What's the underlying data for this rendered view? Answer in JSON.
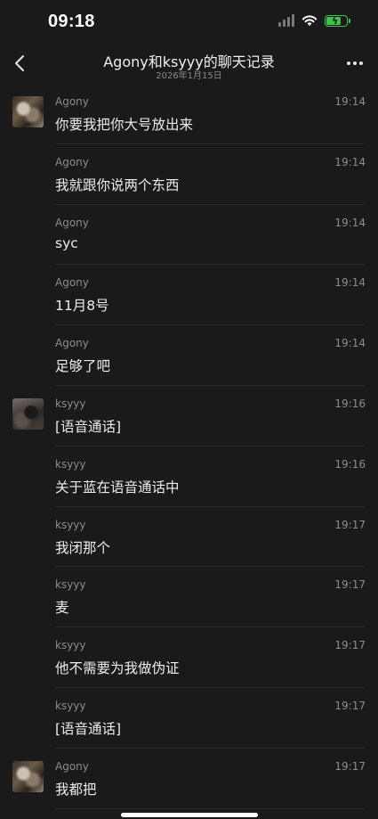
{
  "status_bar": {
    "time": "09:18",
    "battery_color": "#3ec24d",
    "battery_level": 0.8
  },
  "header": {
    "title": "Agony和ksyyy的聊天记录",
    "subtitle": "2026年1月15日",
    "back_icon": "chevron-left-icon",
    "more_icon": "more-dots-icon"
  },
  "messages": [
    {
      "sender": "Agony",
      "time": "19:14",
      "text": "你要我把你大号放出来",
      "avatar": "agony"
    },
    {
      "sender": "Agony",
      "time": "19:14",
      "text": "我就跟你说两个东西",
      "avatar": ""
    },
    {
      "sender": "Agony",
      "time": "19:14",
      "text": "syc",
      "avatar": ""
    },
    {
      "sender": "Agony",
      "time": "19:14",
      "text": "11月8号",
      "avatar": ""
    },
    {
      "sender": "Agony",
      "time": "19:14",
      "text": "足够了吧",
      "avatar": ""
    },
    {
      "sender": "ksyyy",
      "time": "19:16",
      "text": "[语音通话]",
      "avatar": "ksyyy"
    },
    {
      "sender": "ksyyy",
      "time": "19:16",
      "text": "关于蓝在语音通话中",
      "avatar": ""
    },
    {
      "sender": "ksyyy",
      "time": "19:17",
      "text": "我闭那个",
      "avatar": ""
    },
    {
      "sender": "ksyyy",
      "time": "19:17",
      "text": "麦",
      "avatar": ""
    },
    {
      "sender": "ksyyy",
      "time": "19:17",
      "text": "他不需要为我做伪证",
      "avatar": ""
    },
    {
      "sender": "ksyyy",
      "time": "19:17",
      "text": "[语音通话]",
      "avatar": ""
    },
    {
      "sender": "Agony",
      "time": "19:17",
      "text": "我都把",
      "avatar": "agony"
    }
  ]
}
